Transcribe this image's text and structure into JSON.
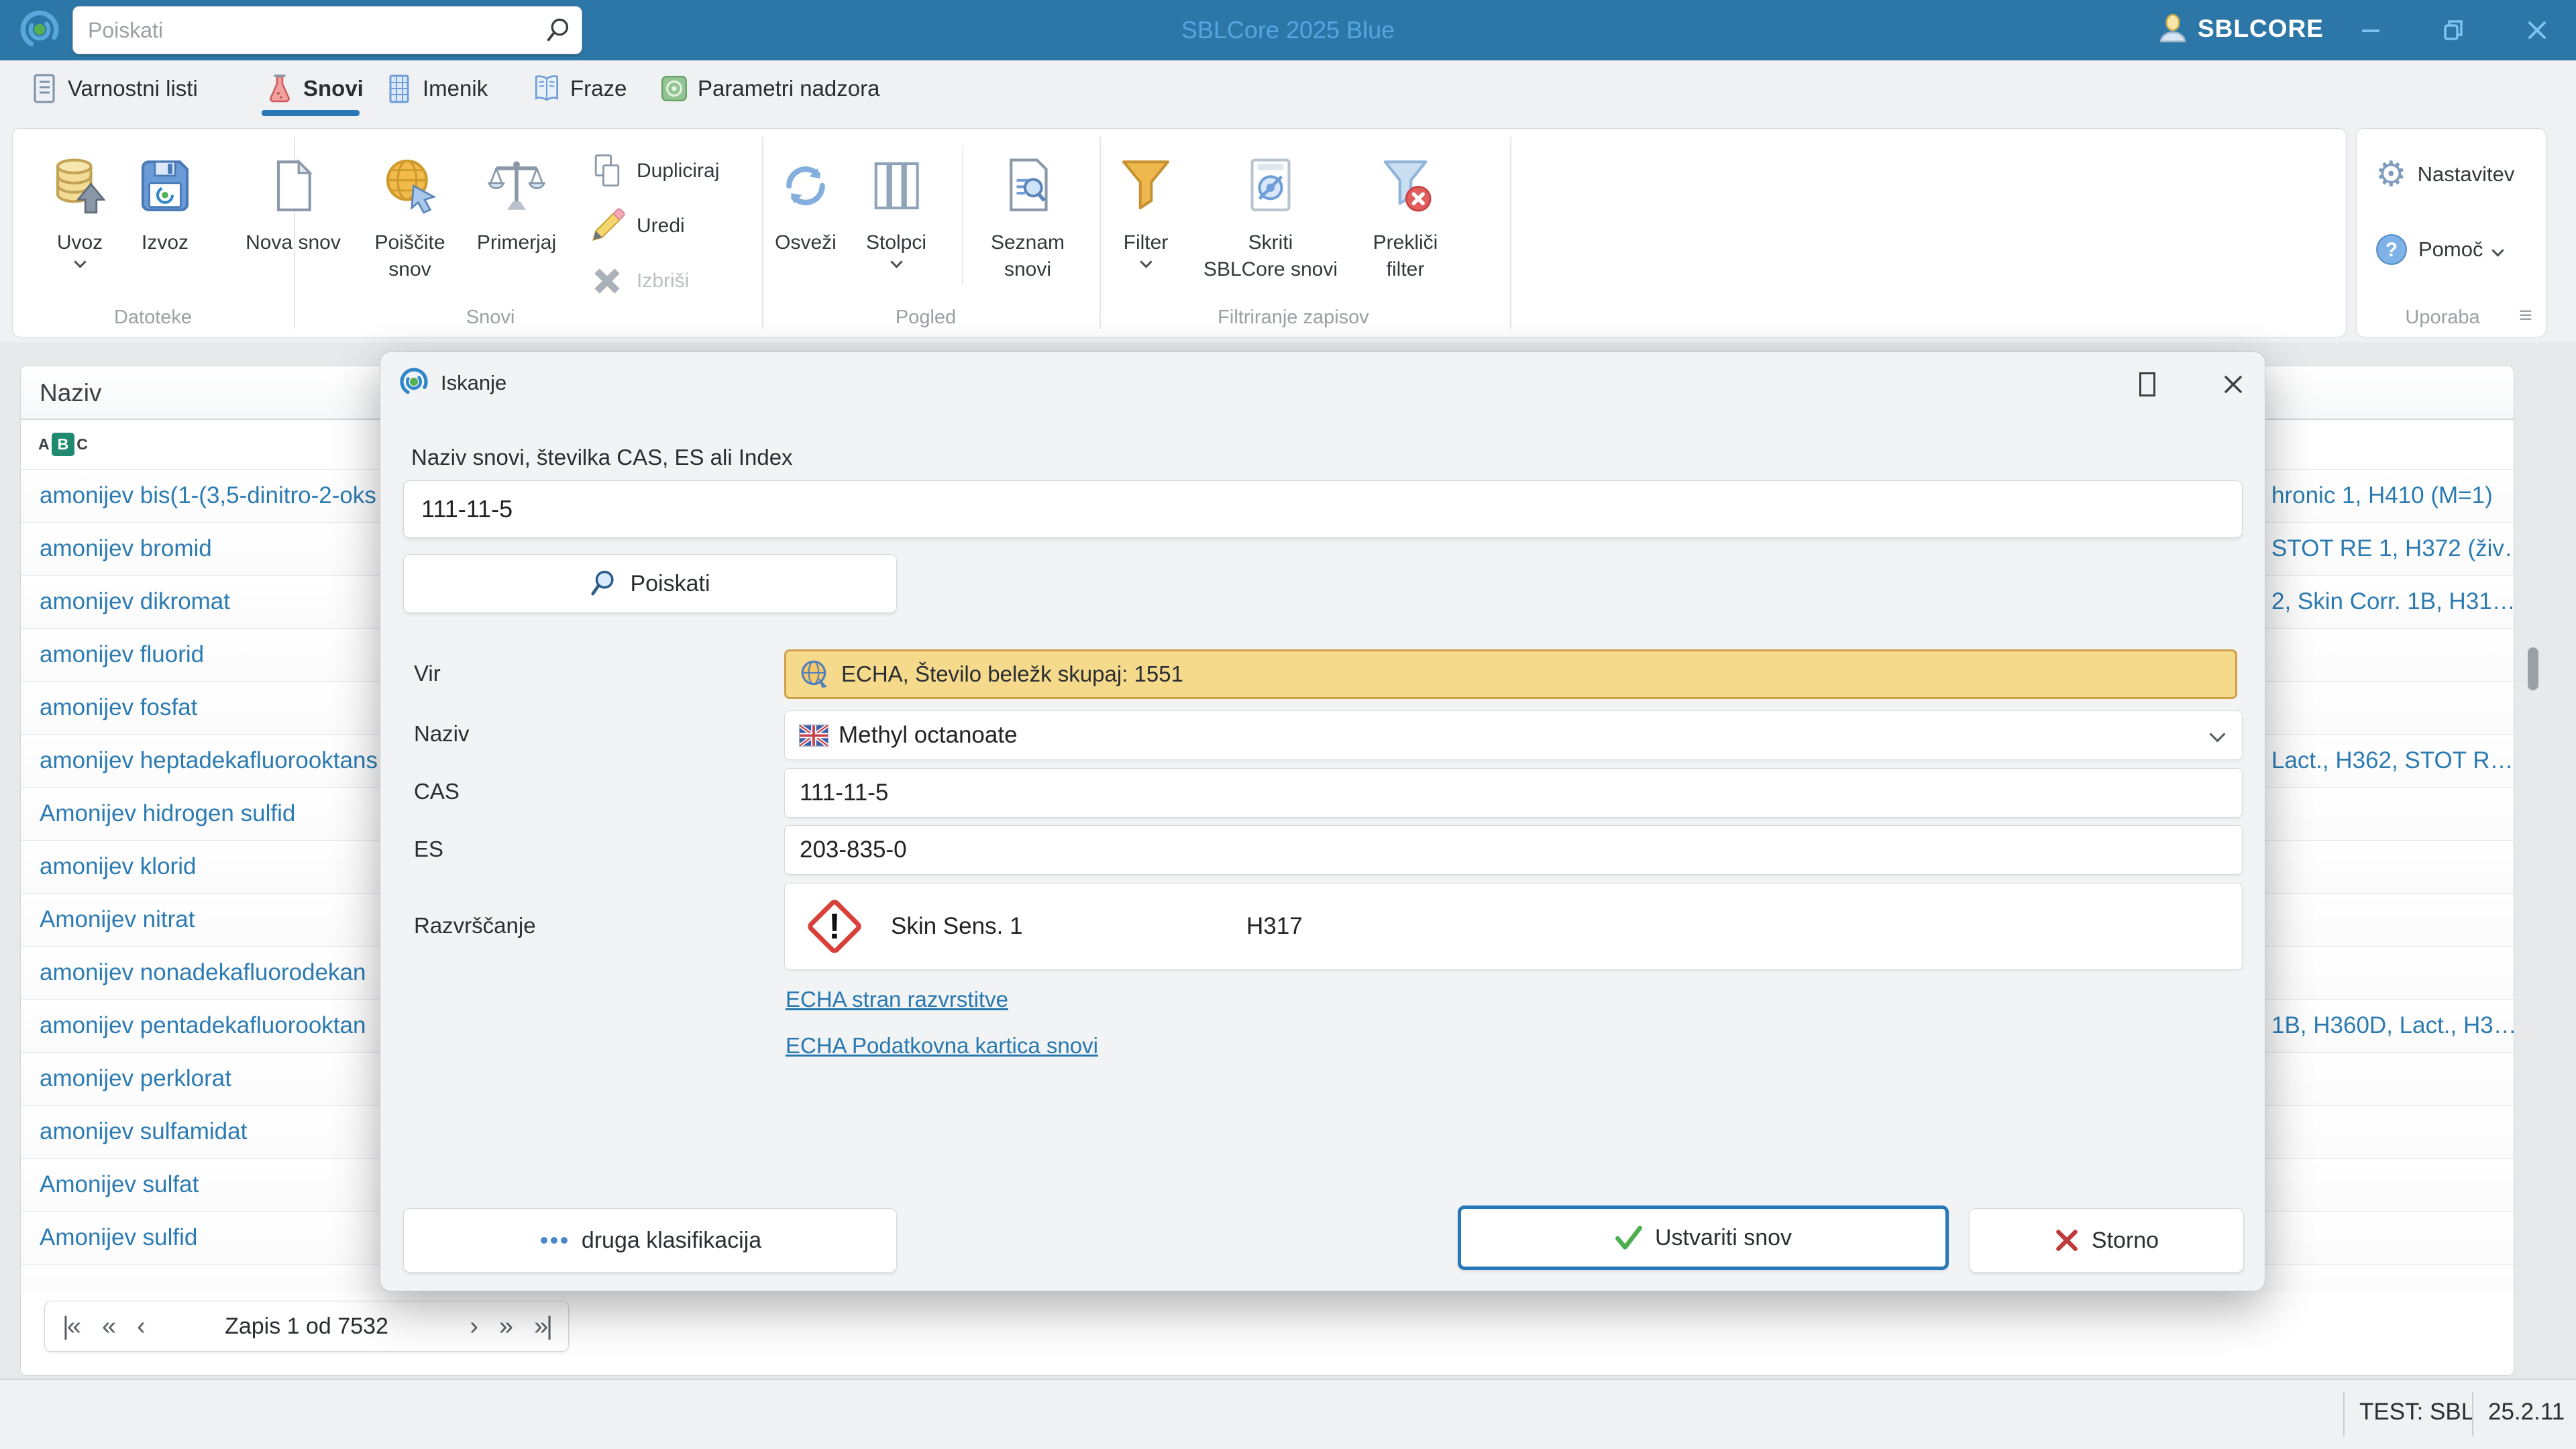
{
  "colors": {
    "titlebar": "#2d76a8",
    "accent": "#2878b0",
    "highlight": "#f6da8c",
    "danger": "#d9403a",
    "success": "#4cae4f"
  },
  "window": {
    "title": "SBLCore 2025 Blue",
    "user": "SBLCORE",
    "search_placeholder": "Poiskati"
  },
  "tabs": {
    "varnostni": "Varnostni listi",
    "snovi": "Snovi",
    "imenik": "Imenik",
    "fraze": "Fraze",
    "parametri": "Parametri nadzora"
  },
  "ribbon": {
    "groups": {
      "datoteke": "Datoteke",
      "snovi": "Snovi",
      "pogled": "Pogled",
      "filtriranje": "Filtriranje zapisov",
      "uporaba": "Uporaba"
    },
    "uvoz": "Uvoz",
    "izvoz": "Izvoz",
    "nova_snov": "Nova snov",
    "poiscite_1": "Poiščite",
    "poiscite_2": "snov",
    "primerjaj": "Primerjaj",
    "dupliciraj": "Dupliciraj",
    "uredi": "Uredi",
    "izbrisi": "Izbriši",
    "osvezi": "Osveži",
    "stolpci": "Stolpci",
    "seznam_1": "Seznam",
    "seznam_2": "snovi",
    "filter": "Filter",
    "skriti_1": "Skriti",
    "skriti_2": "SBLCore snovi",
    "preklici_1": "Prekliči",
    "preklici_2": "filter",
    "nastavitev": "Nastavitev",
    "pomoc": "Pomoč"
  },
  "table": {
    "header": "Naziv",
    "rows": [
      {
        "name": "amonijev bis(1-(3,5-dinitro-2-oks",
        "classification": "hronic 1, H410 (M=1)"
      },
      {
        "name": "amonijev bromid",
        "classification": "STOT RE 1, H372 (živ…"
      },
      {
        "name": "amonijev dikromat",
        "classification": "2, Skin Corr. 1B, H31…"
      },
      {
        "name": "amonijev fluorid",
        "classification": ""
      },
      {
        "name": "amonijev fosfat",
        "classification": ""
      },
      {
        "name": "amonijev heptadekafluorooktans",
        "classification": "Lact., H362, STOT R…"
      },
      {
        "name": "Amonijev hidrogen sulfid",
        "classification": ""
      },
      {
        "name": "amonijev klorid",
        "classification": ""
      },
      {
        "name": "Amonijev nitrat",
        "classification": ""
      },
      {
        "name": "amonijev nonadekafluorodekan",
        "classification": ""
      },
      {
        "name": "amonijev pentadekafluorooktan",
        "classification": "1B, H360D, Lact., H3…"
      },
      {
        "name": "amonijev perklorat",
        "classification": ""
      },
      {
        "name": "amonijev sulfamidat",
        "classification": ""
      },
      {
        "name": "Amonijev sulfat",
        "classification": ""
      },
      {
        "name": "Amonijev sulfid",
        "classification": ""
      },
      {
        "name": "",
        "classification": "",
        "partial": true
      }
    ]
  },
  "pagination": {
    "label": "Zapis 1 od 7532",
    "first_icon": "|«",
    "prev_fast_icon": "«",
    "prev_icon": "‹",
    "next_icon": "›",
    "next_fast_icon": "»",
    "last_icon": "»|"
  },
  "status": {
    "env": "TEST: SBL",
    "version": "25.2.11"
  },
  "dialog": {
    "title": "Iskanje",
    "search_label": "Naziv snovi, številka CAS, ES ali Index",
    "search_value": "111-11-5",
    "search_button": "Poiskati",
    "vir_label": "Vir",
    "vir_value": "ECHA, Število beležk skupaj: 1551",
    "naziv_label": "Naziv",
    "naziv_value": "Methyl octanoate",
    "cas_label": "CAS",
    "cas_value": "111-11-5",
    "es_label": "ES",
    "es_value": "203-835-0",
    "razvrscanje_label": "Razvrščanje",
    "classification_name": "Skin Sens. 1",
    "classification_code": "H317",
    "link_classification": "ECHA stran razvrstitve",
    "link_datasheet": "ECHA Podatkovna kartica snovi",
    "btn_other": "druga klasifikacija",
    "btn_create": "Ustvariti snov",
    "btn_cancel": "Storno"
  }
}
